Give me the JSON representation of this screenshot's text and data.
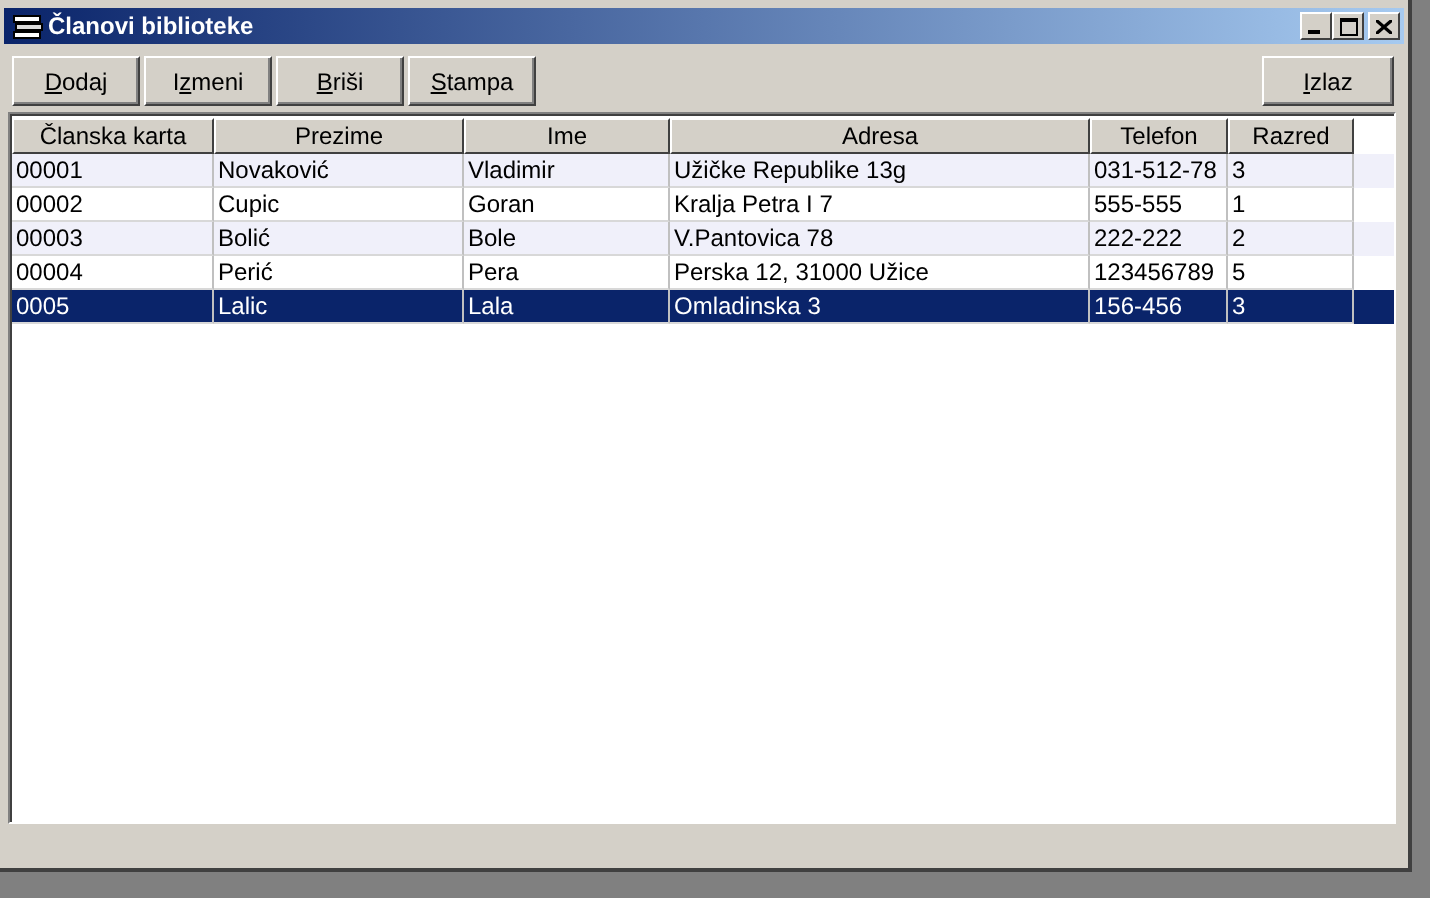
{
  "window": {
    "title": "Članovi biblioteke"
  },
  "toolbar": [
    {
      "access_key": "D",
      "after_key": "odaj"
    },
    {
      "before_key": "I",
      "access_key": "z",
      "after_key": "meni"
    },
    {
      "access_key": "B",
      "after_key": "riši"
    },
    {
      "access_key": "S",
      "after_key": "tampa"
    }
  ],
  "exit_button": {
    "access_key": "I",
    "after_key": "zlaz"
  },
  "table": {
    "columns": [
      "Članska karta",
      "Prezime",
      "Ime",
      "Adresa",
      "Telefon",
      "Razred"
    ],
    "rows": [
      {
        "cells": [
          "00001",
          "Novaković",
          "Vladimir",
          "Užičke Republike 13g",
          "031-512-78",
          "3"
        ],
        "selected": false
      },
      {
        "cells": [
          "00002",
          "Cupic",
          "Goran",
          "Kralja Petra I 7",
          "555-555",
          "1"
        ],
        "selected": false
      },
      {
        "cells": [
          "00003",
          "Bolić",
          "Bole",
          "V.Pantovica 78",
          "222-222",
          "2"
        ],
        "selected": false
      },
      {
        "cells": [
          "00004",
          "Perić",
          "Pera",
          "Perska 12, 31000 Užice",
          "123456789",
          "5"
        ],
        "selected": false
      },
      {
        "cells": [
          "0005",
          "Lalic",
          "Lala",
          "Omladinska 3",
          "156-456",
          "3"
        ],
        "selected": true
      }
    ]
  }
}
